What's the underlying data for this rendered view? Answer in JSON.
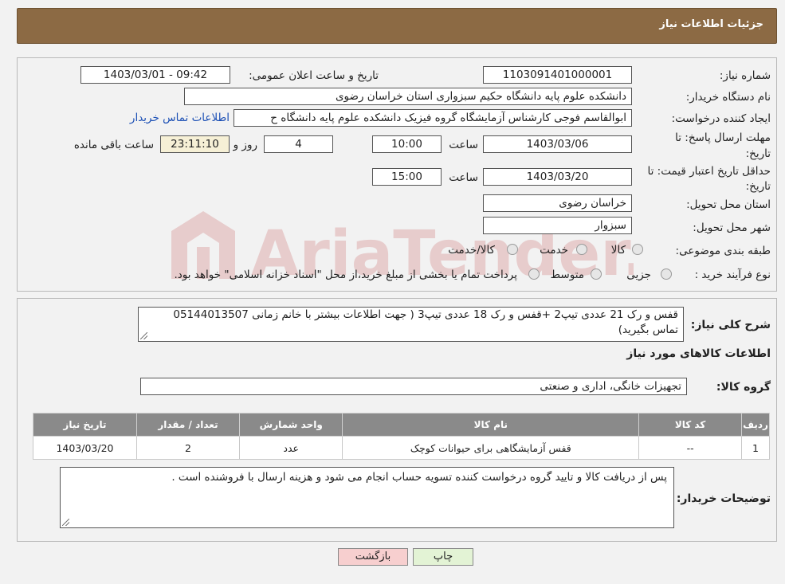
{
  "header": {
    "title": "جزئیات اطلاعات نیاز"
  },
  "info": {
    "need_number_label": "شماره نیاز:",
    "need_number": "1103091401000001",
    "announce_label": "تاریخ و ساعت اعلان عمومی:",
    "announce_value": "1403/03/01 - 09:42",
    "buyer_org_label": "نام دستگاه خریدار:",
    "buyer_org": "دانشکده علوم پایه دانشگاه حکیم سبزواری استان خراسان رضوی",
    "requester_label": "ایجاد کننده درخواست:",
    "requester": "ابوالقاسم فوجی کارشناس آزمایشگاه گروه فیزیک دانشکده علوم پایه دانشگاه ح",
    "contact_link": "اطلاعات تماس خریدار",
    "deadline_label_1": "مهلت ارسال پاسخ: تا",
    "deadline_label_2": "تاریخ:",
    "deadline_date": "1403/03/06",
    "time_label": "ساعت",
    "deadline_time": "10:00",
    "days_value": "4",
    "days_label": "روز و",
    "remaining_time": "23:11:10",
    "remaining_label": "ساعت باقی مانده",
    "validity_label_1": "حداقل تاریخ اعتبار قیمت: تا",
    "validity_label_2": "تاریخ:",
    "validity_date": "1403/03/20",
    "validity_time": "15:00",
    "province_label": "استان محل تحویل:",
    "province": "خراسان رضوی",
    "city_label": "شهر محل تحویل:",
    "city": "سبزوار",
    "category_label": "طبقه بندی موضوعی:",
    "category_options": [
      "کالا",
      "خدمت",
      "کالا/خدمت"
    ],
    "process_label": "نوع فرآیند خرید :",
    "process_options": [
      "جزیی",
      "متوسط"
    ],
    "payment_note": "پرداخت تمام یا بخشی از مبلغ خرید،از محل \"اسناد خزانه اسلامی\" خواهد بود."
  },
  "details": {
    "summary_label": "شرح کلی نیاز:",
    "summary_line1": "قفس و رک 21 عددی تیپ2 +قفس و رک 18 عددی تیپ3 ( جهت اطلاعات بیشتر با خانم زمانی 05144013507",
    "summary_line2": "تماس بگیرید)",
    "goods_info_title": "اطلاعات کالاهای مورد نیاز",
    "goods_group_label": "گروه کالا:",
    "goods_group": "تجهیزات خانگی، اداری و صنعتی",
    "table": {
      "headers": [
        "ردیف",
        "کد کالا",
        "نام کالا",
        "واحد شمارش",
        "تعداد / مقدار",
        "تاریخ نیاز"
      ],
      "rows": [
        [
          "1",
          "--",
          "قفس آزمایشگاهی برای حیوانات کوچک",
          "عدد",
          "2",
          "1403/03/20"
        ]
      ]
    },
    "buyer_notes_label": "توضیحات خریدار:",
    "buyer_notes": "پس از دریافت کالا و تایید گروه درخواست کننده تسویه حساب انجام می شود و  هزینه ارسال با فروشنده است ."
  },
  "buttons": {
    "print": "چاپ",
    "back": "بازگشت"
  },
  "watermark": {
    "text": "AriaTender.neT"
  },
  "colors": {
    "header_bg": "#8c6a44",
    "link": "#1b4fb5",
    "back_btn": "#f7cfcf",
    "print_btn": "#e3f3d5"
  }
}
